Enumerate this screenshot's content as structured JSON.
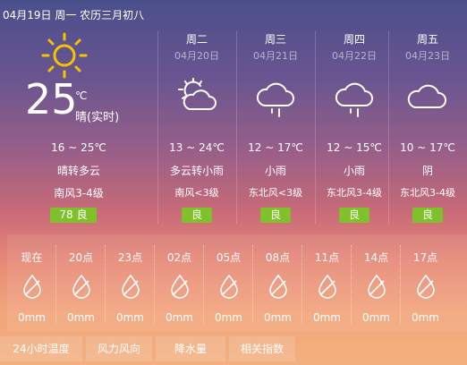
{
  "header": {
    "date_line": "04月19日 周一 农历三月初八"
  },
  "today": {
    "temperature": "25",
    "unit": "℃",
    "condition": "晴(实时)",
    "range": "16 ~ 25℃",
    "desc": "晴转多云",
    "wind": "南风3-4级",
    "aqi_value": "78",
    "aqi_label": "良",
    "icon": "sun-icon"
  },
  "forecast": [
    {
      "day": "周二",
      "date": "04月20日",
      "range": "13 ~ 24℃",
      "desc": "多云转小雨",
      "wind": "南风<3级",
      "aqi": "良",
      "icon": "partly-cloudy-icon"
    },
    {
      "day": "周三",
      "date": "04月21日",
      "range": "12 ~ 17℃",
      "desc": "小雨",
      "wind": "东北风<3级",
      "aqi": "良",
      "icon": "light-rain-icon"
    },
    {
      "day": "周四",
      "date": "04月22日",
      "range": "12 ~ 15℃",
      "desc": "小雨",
      "wind": "东北风3-4级",
      "aqi": "良",
      "icon": "light-rain-icon"
    },
    {
      "day": "周五",
      "date": "04月23日",
      "range": "10 ~ 17℃",
      "desc": "阴",
      "wind": "东北风3-4级",
      "aqi": "良",
      "icon": "cloudy-icon"
    }
  ],
  "hourly": [
    {
      "time": "现在",
      "amount": "0mm"
    },
    {
      "time": "20点",
      "amount": "0mm"
    },
    {
      "time": "23点",
      "amount": "0mm"
    },
    {
      "time": "02点",
      "amount": "0mm"
    },
    {
      "time": "05点",
      "amount": "0mm"
    },
    {
      "time": "08点",
      "amount": "0mm"
    },
    {
      "time": "11点",
      "amount": "0mm"
    },
    {
      "time": "14点",
      "amount": "0mm"
    },
    {
      "time": "17点",
      "amount": "0mm"
    }
  ],
  "tabs": [
    "24小时温度",
    "风力风向",
    "降水量",
    "相关指数"
  ],
  "colors": {
    "aqi_good": "#7fc12b",
    "sun": "#f5c400"
  }
}
